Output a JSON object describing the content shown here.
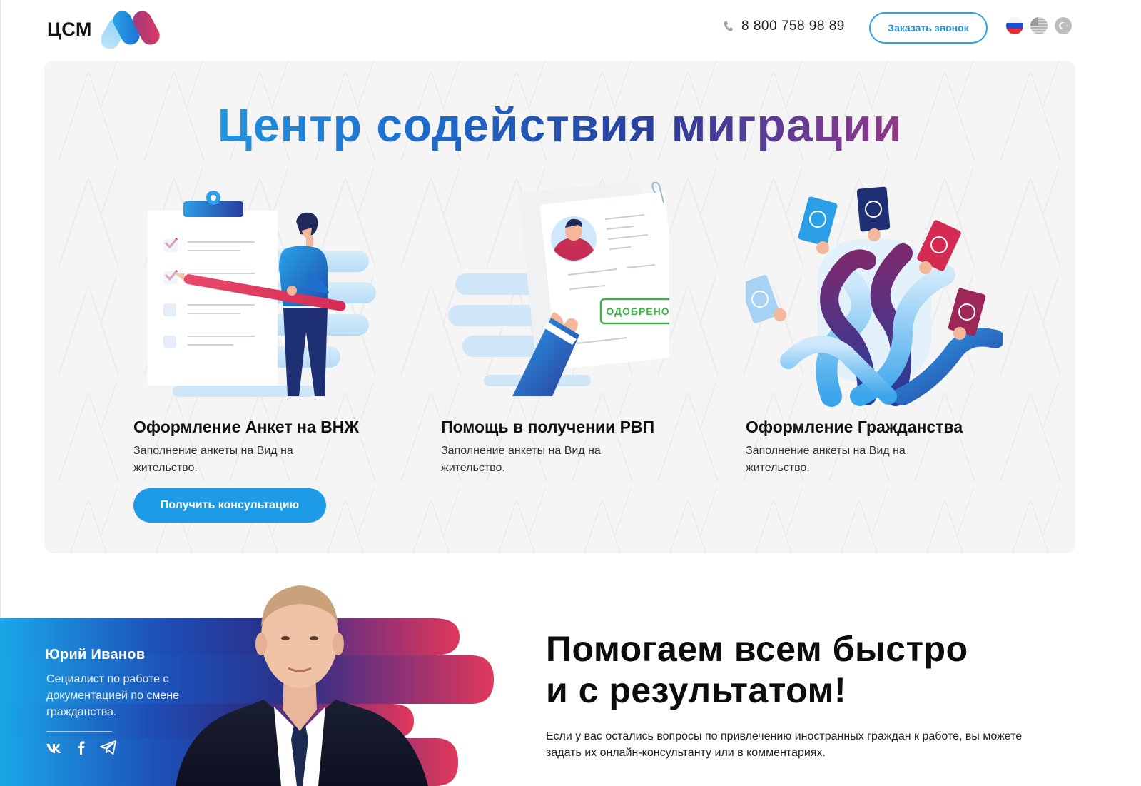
{
  "header": {
    "logo_text": "ЦСМ",
    "phone": "8 800 758 98 89",
    "callback_label": "Заказать звонок",
    "languages": [
      "ru-flag-icon",
      "us-flag-icon",
      "tr-flag-icon"
    ]
  },
  "hero": {
    "title": "Центр содействия миграции",
    "cards": [
      {
        "title": "Оформление Анкет на ВНЖ",
        "desc": "Заполнение анкеты на Вид на жительство.",
        "icon": "clipboard-person-illustration"
      },
      {
        "title": "Помощь в получении РВП",
        "desc": "Заполнение анкеты на Вид на жительство.",
        "icon": "approved-document-illustration",
        "stamp": "ОДОБРЕНО"
      },
      {
        "title": "Оформление Гражданства",
        "desc": "Заполнение анкеты на Вид на жительство.",
        "icon": "passports-hands-illustration"
      }
    ],
    "consult_label": "Получить консультацию"
  },
  "agent": {
    "name": "Юрий Иванов",
    "role": "Сециалист по работе с документацией по смене гражданства.",
    "socials": [
      "vk-icon",
      "facebook-icon",
      "telegram-icon"
    ]
  },
  "promo": {
    "headline_line1": "Помогаем всем быстро",
    "headline_line2": "и с результатом!",
    "text": "Если у вас остались вопросы по привлечению иностранных граждан к работе, вы можете задать их онлайн-консультанту или в комментариях."
  },
  "colors": {
    "accent_blue": "#1e9be6",
    "brand_light": "#25b7ee",
    "brand_navy": "#2a3c9c",
    "brand_red": "#d8345e",
    "hero_bg": "#f5f5f6"
  }
}
